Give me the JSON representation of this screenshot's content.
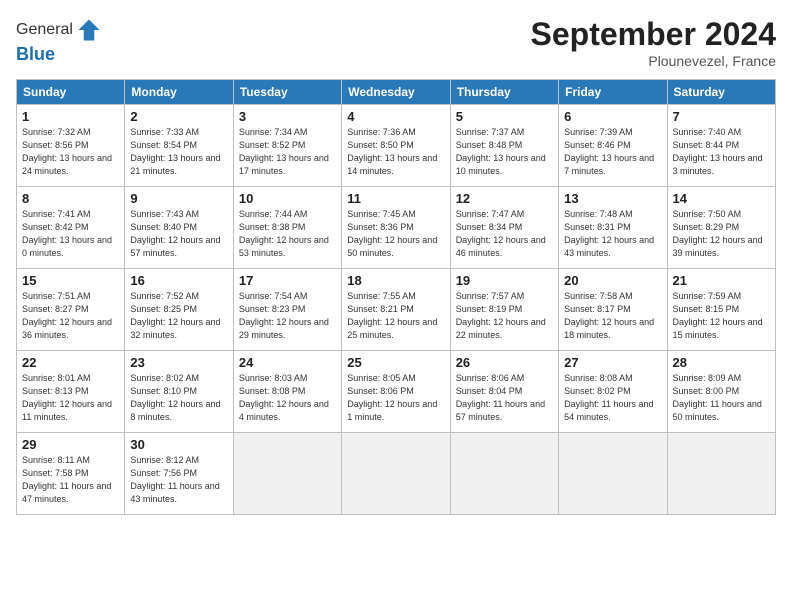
{
  "logo": {
    "general": "General",
    "blue": "Blue"
  },
  "header": {
    "month_title": "September 2024",
    "location": "Plounevezel, France"
  },
  "weekdays": [
    "Sunday",
    "Monday",
    "Tuesday",
    "Wednesday",
    "Thursday",
    "Friday",
    "Saturday"
  ],
  "weeks": [
    [
      {
        "day": "1",
        "sunrise": "Sunrise: 7:32 AM",
        "sunset": "Sunset: 8:56 PM",
        "daylight": "Daylight: 13 hours and 24 minutes."
      },
      {
        "day": "2",
        "sunrise": "Sunrise: 7:33 AM",
        "sunset": "Sunset: 8:54 PM",
        "daylight": "Daylight: 13 hours and 21 minutes."
      },
      {
        "day": "3",
        "sunrise": "Sunrise: 7:34 AM",
        "sunset": "Sunset: 8:52 PM",
        "daylight": "Daylight: 13 hours and 17 minutes."
      },
      {
        "day": "4",
        "sunrise": "Sunrise: 7:36 AM",
        "sunset": "Sunset: 8:50 PM",
        "daylight": "Daylight: 13 hours and 14 minutes."
      },
      {
        "day": "5",
        "sunrise": "Sunrise: 7:37 AM",
        "sunset": "Sunset: 8:48 PM",
        "daylight": "Daylight: 13 hours and 10 minutes."
      },
      {
        "day": "6",
        "sunrise": "Sunrise: 7:39 AM",
        "sunset": "Sunset: 8:46 PM",
        "daylight": "Daylight: 13 hours and 7 minutes."
      },
      {
        "day": "7",
        "sunrise": "Sunrise: 7:40 AM",
        "sunset": "Sunset: 8:44 PM",
        "daylight": "Daylight: 13 hours and 3 minutes."
      }
    ],
    [
      {
        "day": "8",
        "sunrise": "Sunrise: 7:41 AM",
        "sunset": "Sunset: 8:42 PM",
        "daylight": "Daylight: 13 hours and 0 minutes."
      },
      {
        "day": "9",
        "sunrise": "Sunrise: 7:43 AM",
        "sunset": "Sunset: 8:40 PM",
        "daylight": "Daylight: 12 hours and 57 minutes."
      },
      {
        "day": "10",
        "sunrise": "Sunrise: 7:44 AM",
        "sunset": "Sunset: 8:38 PM",
        "daylight": "Daylight: 12 hours and 53 minutes."
      },
      {
        "day": "11",
        "sunrise": "Sunrise: 7:45 AM",
        "sunset": "Sunset: 8:36 PM",
        "daylight": "Daylight: 12 hours and 50 minutes."
      },
      {
        "day": "12",
        "sunrise": "Sunrise: 7:47 AM",
        "sunset": "Sunset: 8:34 PM",
        "daylight": "Daylight: 12 hours and 46 minutes."
      },
      {
        "day": "13",
        "sunrise": "Sunrise: 7:48 AM",
        "sunset": "Sunset: 8:31 PM",
        "daylight": "Daylight: 12 hours and 43 minutes."
      },
      {
        "day": "14",
        "sunrise": "Sunrise: 7:50 AM",
        "sunset": "Sunset: 8:29 PM",
        "daylight": "Daylight: 12 hours and 39 minutes."
      }
    ],
    [
      {
        "day": "15",
        "sunrise": "Sunrise: 7:51 AM",
        "sunset": "Sunset: 8:27 PM",
        "daylight": "Daylight: 12 hours and 36 minutes."
      },
      {
        "day": "16",
        "sunrise": "Sunrise: 7:52 AM",
        "sunset": "Sunset: 8:25 PM",
        "daylight": "Daylight: 12 hours and 32 minutes."
      },
      {
        "day": "17",
        "sunrise": "Sunrise: 7:54 AM",
        "sunset": "Sunset: 8:23 PM",
        "daylight": "Daylight: 12 hours and 29 minutes."
      },
      {
        "day": "18",
        "sunrise": "Sunrise: 7:55 AM",
        "sunset": "Sunset: 8:21 PM",
        "daylight": "Daylight: 12 hours and 25 minutes."
      },
      {
        "day": "19",
        "sunrise": "Sunrise: 7:57 AM",
        "sunset": "Sunset: 8:19 PM",
        "daylight": "Daylight: 12 hours and 22 minutes."
      },
      {
        "day": "20",
        "sunrise": "Sunrise: 7:58 AM",
        "sunset": "Sunset: 8:17 PM",
        "daylight": "Daylight: 12 hours and 18 minutes."
      },
      {
        "day": "21",
        "sunrise": "Sunrise: 7:59 AM",
        "sunset": "Sunset: 8:15 PM",
        "daylight": "Daylight: 12 hours and 15 minutes."
      }
    ],
    [
      {
        "day": "22",
        "sunrise": "Sunrise: 8:01 AM",
        "sunset": "Sunset: 8:13 PM",
        "daylight": "Daylight: 12 hours and 11 minutes."
      },
      {
        "day": "23",
        "sunrise": "Sunrise: 8:02 AM",
        "sunset": "Sunset: 8:10 PM",
        "daylight": "Daylight: 12 hours and 8 minutes."
      },
      {
        "day": "24",
        "sunrise": "Sunrise: 8:03 AM",
        "sunset": "Sunset: 8:08 PM",
        "daylight": "Daylight: 12 hours and 4 minutes."
      },
      {
        "day": "25",
        "sunrise": "Sunrise: 8:05 AM",
        "sunset": "Sunset: 8:06 PM",
        "daylight": "Daylight: 12 hours and 1 minute."
      },
      {
        "day": "26",
        "sunrise": "Sunrise: 8:06 AM",
        "sunset": "Sunset: 8:04 PM",
        "daylight": "Daylight: 11 hours and 57 minutes."
      },
      {
        "day": "27",
        "sunrise": "Sunrise: 8:08 AM",
        "sunset": "Sunset: 8:02 PM",
        "daylight": "Daylight: 11 hours and 54 minutes."
      },
      {
        "day": "28",
        "sunrise": "Sunrise: 8:09 AM",
        "sunset": "Sunset: 8:00 PM",
        "daylight": "Daylight: 11 hours and 50 minutes."
      }
    ],
    [
      {
        "day": "29",
        "sunrise": "Sunrise: 8:11 AM",
        "sunset": "Sunset: 7:58 PM",
        "daylight": "Daylight: 11 hours and 47 minutes."
      },
      {
        "day": "30",
        "sunrise": "Sunrise: 8:12 AM",
        "sunset": "Sunset: 7:56 PM",
        "daylight": "Daylight: 11 hours and 43 minutes."
      },
      null,
      null,
      null,
      null,
      null
    ]
  ]
}
